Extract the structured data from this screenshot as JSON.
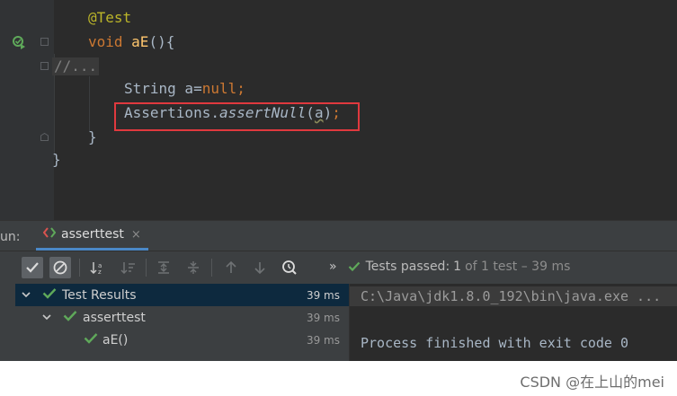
{
  "editor": {
    "annotation": "@Test",
    "method_kw": "void",
    "method_name": "aE",
    "method_sig": "(){",
    "folded_comment": "//...",
    "line_string_type": "String",
    "line_string_var": " a=",
    "line_string_null": "null",
    "line_string_end": ";",
    "assert_class": "Assertions.",
    "assert_method": "assertNull",
    "assert_open": "(",
    "assert_arg": "a",
    "assert_close": ")",
    "assert_semi": ";",
    "brace_inner": "}",
    "brace_outer": "}"
  },
  "run_bar": {
    "label": "un:",
    "tab_label": "asserttest",
    "tab_close": "×"
  },
  "toolbar": {
    "status_prefix": "»",
    "status_label": "Tests passed:",
    "status_count": "1",
    "status_rest": "of 1 test – 39 ms"
  },
  "results": {
    "rows": [
      {
        "label": "Test Results",
        "time": "39 ms"
      },
      {
        "label": "asserttest",
        "time": "39 ms"
      },
      {
        "label": "aE()",
        "time": "39 ms"
      }
    ]
  },
  "console": {
    "command": "C:\\Java\\jdk1.8.0_192\\bin\\java.exe ...",
    "exit_message": "Process finished with exit code 0"
  },
  "watermark": "CSDN @在上山的mei",
  "colors": {
    "accent_pass": "#5fa95a",
    "highlight_border": "#e0393e",
    "selected_row": "#0d293e"
  }
}
